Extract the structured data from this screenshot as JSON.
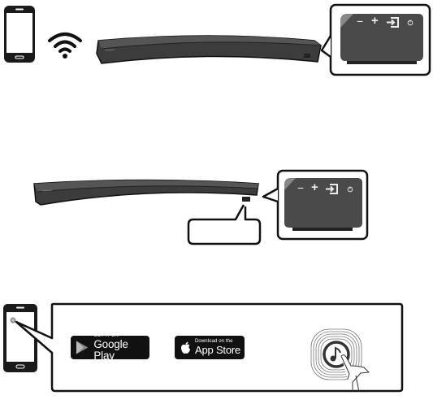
{
  "step1": {
    "phone": "smartphone-icon",
    "wifi": "wifi-icon",
    "soundbar": "curved-soundbar",
    "panel_buttons": [
      "−",
      "+",
      "source",
      "power"
    ]
  },
  "step2": {
    "soundbar": "curved-soundbar",
    "panel_buttons": [
      "−",
      "+",
      "source",
      "power"
    ],
    "callout_label": ""
  },
  "step3": {
    "phone": "smartphone-with-app-icon",
    "google_play": {
      "small": "GET IT ON",
      "big": "Google Play"
    },
    "app_store": {
      "small": "Download on the",
      "big": "App Store"
    },
    "app_icon": "music-app-icon"
  },
  "colors": {
    "outline": "#111111",
    "soundbar": "#3e3e3e",
    "panel": "#4a4a4a",
    "badge": "#111111"
  }
}
